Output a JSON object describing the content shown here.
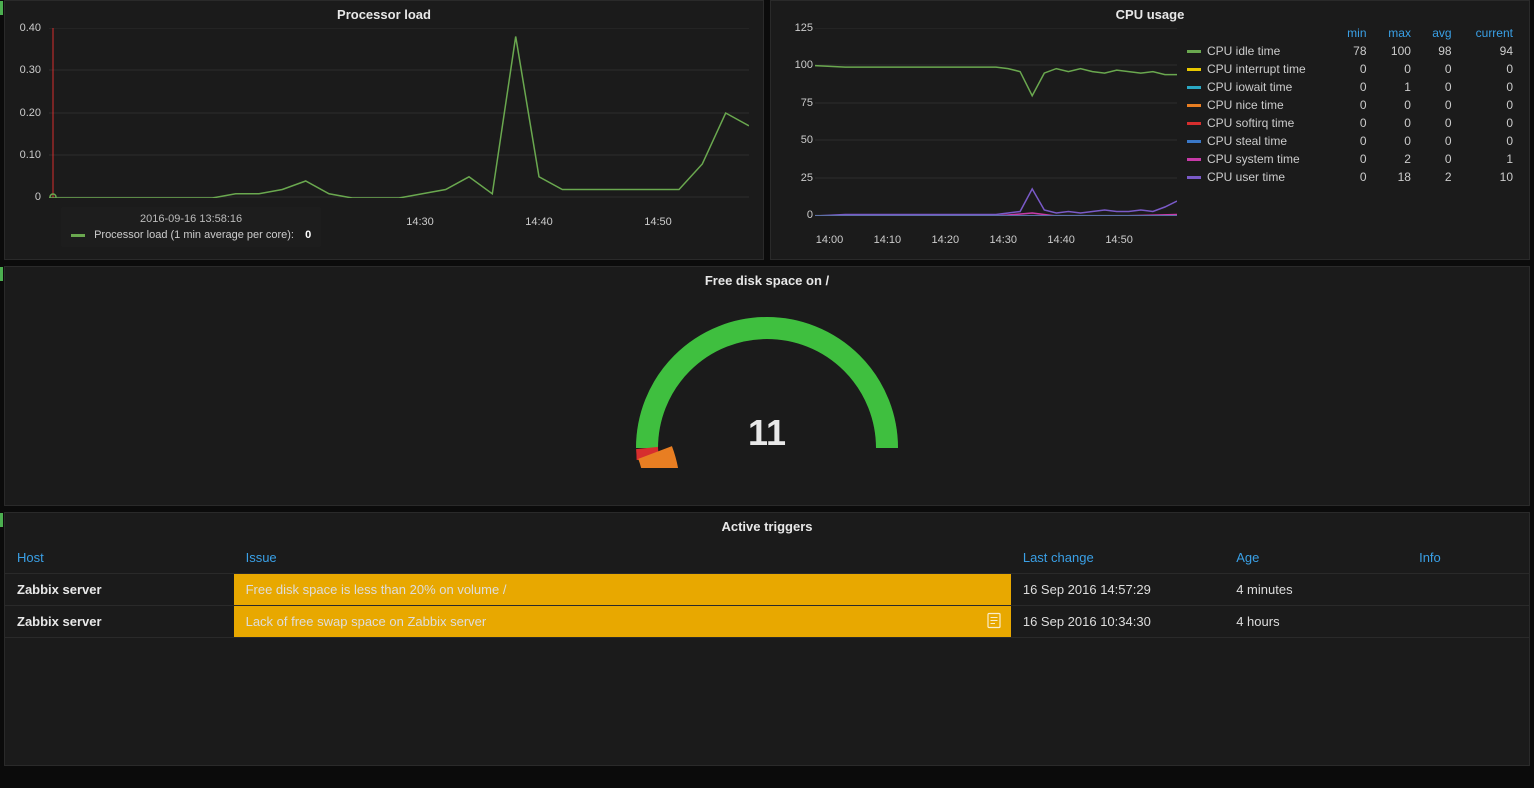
{
  "processor_load": {
    "title": "Processor load",
    "tooltip_ts": "2016-09-16 13:58:16",
    "legend_label": "Processor load (1 min average per core):",
    "legend_value": "0"
  },
  "cpu_usage": {
    "title": "CPU usage",
    "headers": {
      "min": "min",
      "max": "max",
      "avg": "avg",
      "current": "current"
    },
    "series": [
      {
        "name": "CPU idle time",
        "color": "#6aa84f",
        "min": 78,
        "max": 100,
        "avg": 98,
        "current": 94
      },
      {
        "name": "CPU interrupt time",
        "color": "#e8c800",
        "min": 0,
        "max": 0,
        "avg": 0,
        "current": 0
      },
      {
        "name": "CPU iowait time",
        "color": "#2aa8c4",
        "min": 0,
        "max": 1,
        "avg": 0,
        "current": 0
      },
      {
        "name": "CPU nice time",
        "color": "#e87e22",
        "min": 0,
        "max": 0,
        "avg": 0,
        "current": 0
      },
      {
        "name": "CPU softirq time",
        "color": "#d62e2e",
        "min": 0,
        "max": 0,
        "avg": 0,
        "current": 0
      },
      {
        "name": "CPU steal time",
        "color": "#3a78c8",
        "min": 0,
        "max": 0,
        "avg": 0,
        "current": 0
      },
      {
        "name": "CPU system time",
        "color": "#c83aa8",
        "min": 0,
        "max": 2,
        "avg": 0,
        "current": 1
      },
      {
        "name": "CPU user time",
        "color": "#7a5ac8",
        "min": 0,
        "max": 18,
        "avg": 2,
        "current": 10
      }
    ]
  },
  "disk_gauge": {
    "title": "Free disk space on /",
    "value": "11"
  },
  "triggers": {
    "title": "Active triggers",
    "headers": {
      "host": "Host",
      "issue": "Issue",
      "last_change": "Last change",
      "age": "Age",
      "info": "Info"
    },
    "rows": [
      {
        "host": "Zabbix server",
        "issue": "Free disk space is less than 20% on volume /",
        "last_change": "16 Sep 2016 14:57:29",
        "age": "4 minutes",
        "has_doc": false
      },
      {
        "host": "Zabbix server",
        "issue": "Lack of free swap space on Zabbix server",
        "last_change": "16 Sep 2016 10:34:30",
        "age": "4 hours",
        "has_doc": true
      }
    ]
  },
  "chart_data": [
    {
      "type": "line",
      "title": "Processor load",
      "ylim": [
        0,
        0.4
      ],
      "yticks": [
        0,
        0.1,
        0.2,
        0.3,
        0.4
      ],
      "xticks": [
        "14:30",
        "14:40",
        "14:50"
      ],
      "series": [
        {
          "name": "Processor load (1 min average per core)",
          "color": "#6aa84f",
          "x": [
            0,
            2,
            4,
            6,
            8,
            10,
            12,
            14,
            16,
            18,
            20,
            22,
            24,
            26,
            28,
            30,
            32,
            34,
            36,
            38,
            40,
            42,
            44,
            46,
            48,
            50,
            52,
            54,
            56,
            58,
            60
          ],
          "y": [
            0,
            0,
            0,
            0,
            0,
            0,
            0,
            0,
            0.01,
            0.01,
            0.02,
            0.04,
            0.01,
            0,
            0,
            0,
            0.01,
            0.02,
            0.05,
            0.01,
            0.38,
            0.05,
            0.02,
            0.02,
            0.02,
            0.02,
            0.02,
            0.02,
            0.08,
            0.2,
            0.17
          ]
        }
      ]
    },
    {
      "type": "line",
      "title": "CPU usage",
      "ylim": [
        0,
        125
      ],
      "yticks": [
        0,
        25,
        50,
        75,
        100,
        125
      ],
      "xticks": [
        "14:00",
        "14:10",
        "14:20",
        "14:30",
        "14:40",
        "14:50"
      ],
      "series": [
        {
          "name": "CPU idle time",
          "color": "#6aa84f",
          "x": [
            0,
            5,
            10,
            15,
            20,
            25,
            30,
            32,
            34,
            36,
            38,
            40,
            42,
            44,
            46,
            48,
            50,
            52,
            54,
            56,
            58,
            60
          ],
          "y": [
            100,
            99,
            99,
            99,
            99,
            99,
            99,
            98,
            96,
            80,
            95,
            98,
            96,
            98,
            96,
            95,
            97,
            96,
            95,
            96,
            94,
            94
          ]
        },
        {
          "name": "CPU user time",
          "color": "#7a5ac8",
          "x": [
            0,
            5,
            10,
            15,
            20,
            25,
            30,
            32,
            34,
            36,
            38,
            40,
            42,
            44,
            46,
            48,
            50,
            52,
            54,
            56,
            58,
            60
          ],
          "y": [
            0,
            1,
            1,
            1,
            1,
            1,
            1,
            2,
            3,
            18,
            4,
            2,
            3,
            2,
            3,
            4,
            3,
            3,
            4,
            3,
            6,
            10
          ]
        },
        {
          "name": "CPU system time",
          "color": "#c83aa8",
          "x": [
            0,
            10,
            20,
            30,
            36,
            40,
            50,
            60
          ],
          "y": [
            0,
            0,
            0,
            0,
            2,
            0,
            0,
            1
          ]
        },
        {
          "name": "CPU interrupt time",
          "color": "#e8c800",
          "x": [
            0,
            60
          ],
          "y": [
            0,
            0
          ]
        },
        {
          "name": "CPU iowait time",
          "color": "#2aa8c4",
          "x": [
            0,
            60
          ],
          "y": [
            0,
            0
          ]
        },
        {
          "name": "CPU nice time",
          "color": "#e87e22",
          "x": [
            0,
            60
          ],
          "y": [
            0,
            0
          ]
        },
        {
          "name": "CPU softirq time",
          "color": "#d62e2e",
          "x": [
            0,
            60
          ],
          "y": [
            0,
            0
          ]
        },
        {
          "name": "CPU steal time",
          "color": "#3a78c8",
          "x": [
            0,
            60
          ],
          "y": [
            0,
            0
          ]
        }
      ]
    },
    {
      "type": "gauge",
      "title": "Free disk space on /",
      "value": 11,
      "range": [
        0,
        100
      ]
    }
  ]
}
